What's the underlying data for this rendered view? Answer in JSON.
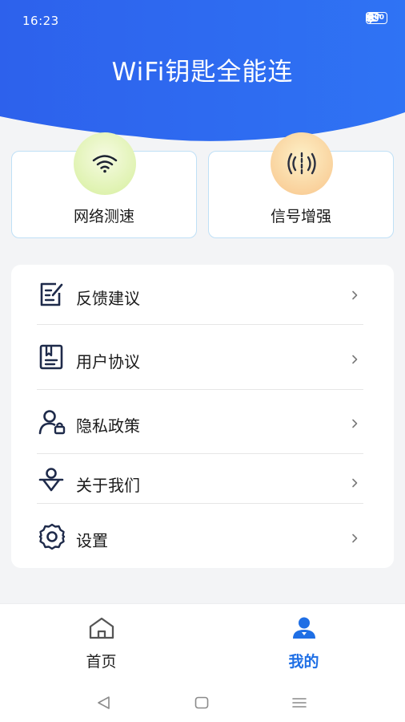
{
  "status_bar": {
    "time": "16:23",
    "battery": "100"
  },
  "header": {
    "title": "WiFi钥匙全能连"
  },
  "features": [
    {
      "label": "网络测速",
      "icon": "wifi-icon"
    },
    {
      "label": "信号增强",
      "icon": "signal-icon"
    }
  ],
  "menu": {
    "items": [
      {
        "label": "反馈建议",
        "icon": "feedback-icon"
      },
      {
        "label": "用户协议",
        "icon": "agreement-icon"
      },
      {
        "label": "隐私政策",
        "icon": "privacy-icon"
      },
      {
        "label": "关于我们",
        "icon": "about-icon"
      },
      {
        "label": "设置",
        "icon": "settings-icon"
      }
    ]
  },
  "tab_bar": {
    "tabs": [
      {
        "label": "首页",
        "icon": "home-icon",
        "active": false
      },
      {
        "label": "我的",
        "icon": "profile-icon",
        "active": true
      }
    ]
  },
  "colors": {
    "primary": "#2a6cf2",
    "active_tab": "#1f6fe5",
    "inactive_tab": "#222222",
    "icon_dark": "#1e2a4a"
  }
}
